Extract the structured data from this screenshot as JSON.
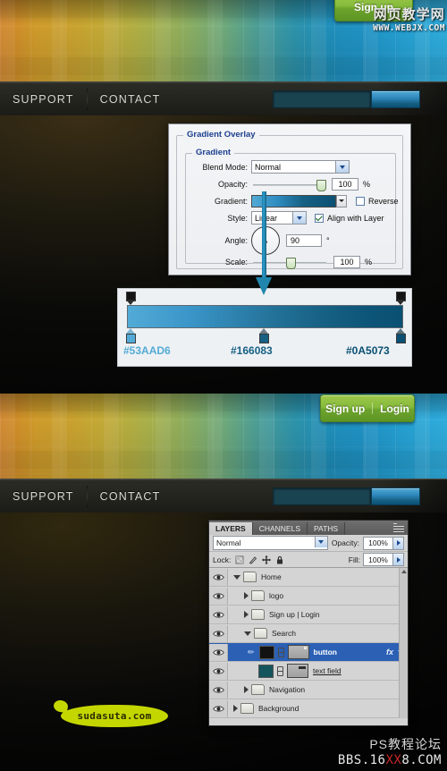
{
  "watermarks": {
    "top_cn": "网页教学网",
    "top_en": "WWW.WEBJX.COM",
    "bottom_cn": "PS教程论坛",
    "bottom_en_pre": "BBS.16",
    "bottom_en_hl": "XX",
    "bottom_en_post": "8.COM",
    "logo_text": "sudasuta.com"
  },
  "site_mock": {
    "nav": {
      "support": "SUPPORT",
      "contact": "CONTACT"
    },
    "search": {
      "value": "",
      "placeholder": ""
    },
    "buttons": {
      "sign_up": "Sign up",
      "login": "Login",
      "separator": "|"
    }
  },
  "dialog": {
    "title": "Gradient Overlay",
    "group_title": "Gradient",
    "fields": {
      "blend_mode_label": "Blend Mode:",
      "blend_mode_value": "Normal",
      "opacity_label": "Opacity:",
      "opacity_value": "100",
      "opacity_unit": "%",
      "gradient_label": "Gradient:",
      "reverse_label": "Reverse",
      "reverse_checked": false,
      "style_label": "Style:",
      "style_value": "Linear",
      "align_label": "Align with Layer",
      "align_checked": true,
      "angle_label": "Angle:",
      "angle_value": "90",
      "angle_unit": "°",
      "scale_label": "Scale:",
      "scale_value": "100",
      "scale_unit": "%"
    }
  },
  "gradient_strip": {
    "stops": [
      {
        "hex": "#53AAD6",
        "position": 0
      },
      {
        "hex": "#166083",
        "position": 50
      },
      {
        "hex": "#0A5073",
        "position": 100
      }
    ],
    "labels": {
      "left": "#53AAD6",
      "mid": "#166083",
      "right": "#0A5073"
    }
  },
  "layers_panel": {
    "tabs": [
      {
        "label": "LAYERS",
        "active": true
      },
      {
        "label": "CHANNELS",
        "active": false
      },
      {
        "label": "PATHS",
        "active": false
      }
    ],
    "blend_mode": "Normal",
    "opacity_label": "Opacity:",
    "opacity_value": "100%",
    "lock_label": "Lock:",
    "fill_label": "Fill:",
    "fill_value": "100%",
    "rows": [
      {
        "name": "Home",
        "type": "group",
        "expanded": true,
        "indent": 0,
        "selected": false
      },
      {
        "name": "logo",
        "type": "group",
        "expanded": false,
        "indent": 1,
        "selected": false
      },
      {
        "name": "Sign up  |  Login",
        "type": "group",
        "expanded": false,
        "indent": 1,
        "selected": false
      },
      {
        "name": "Search",
        "type": "group",
        "expanded": true,
        "indent": 1,
        "selected": false
      },
      {
        "name": "button",
        "type": "layer",
        "indent": 2,
        "selected": true,
        "thumb_color": "#121212",
        "has_mask": true,
        "fx": "fx"
      },
      {
        "name": "text field",
        "type": "layer",
        "indent": 2,
        "selected": false,
        "thumb_color": "#14545c",
        "has_mask": true
      },
      {
        "name": "Navigation",
        "type": "group",
        "expanded": false,
        "indent": 1,
        "selected": false
      },
      {
        "name": "Background",
        "type": "group",
        "expanded": false,
        "indent": 0,
        "selected": false
      }
    ]
  },
  "colors": {
    "gradient_start": "#53AAD6",
    "gradient_mid": "#166083",
    "gradient_end": "#0A5073",
    "pointer": "#2186AD",
    "green_button": "#86BB3C",
    "dialog_title": "#1C3F8F",
    "selection": "#2B60B4"
  }
}
